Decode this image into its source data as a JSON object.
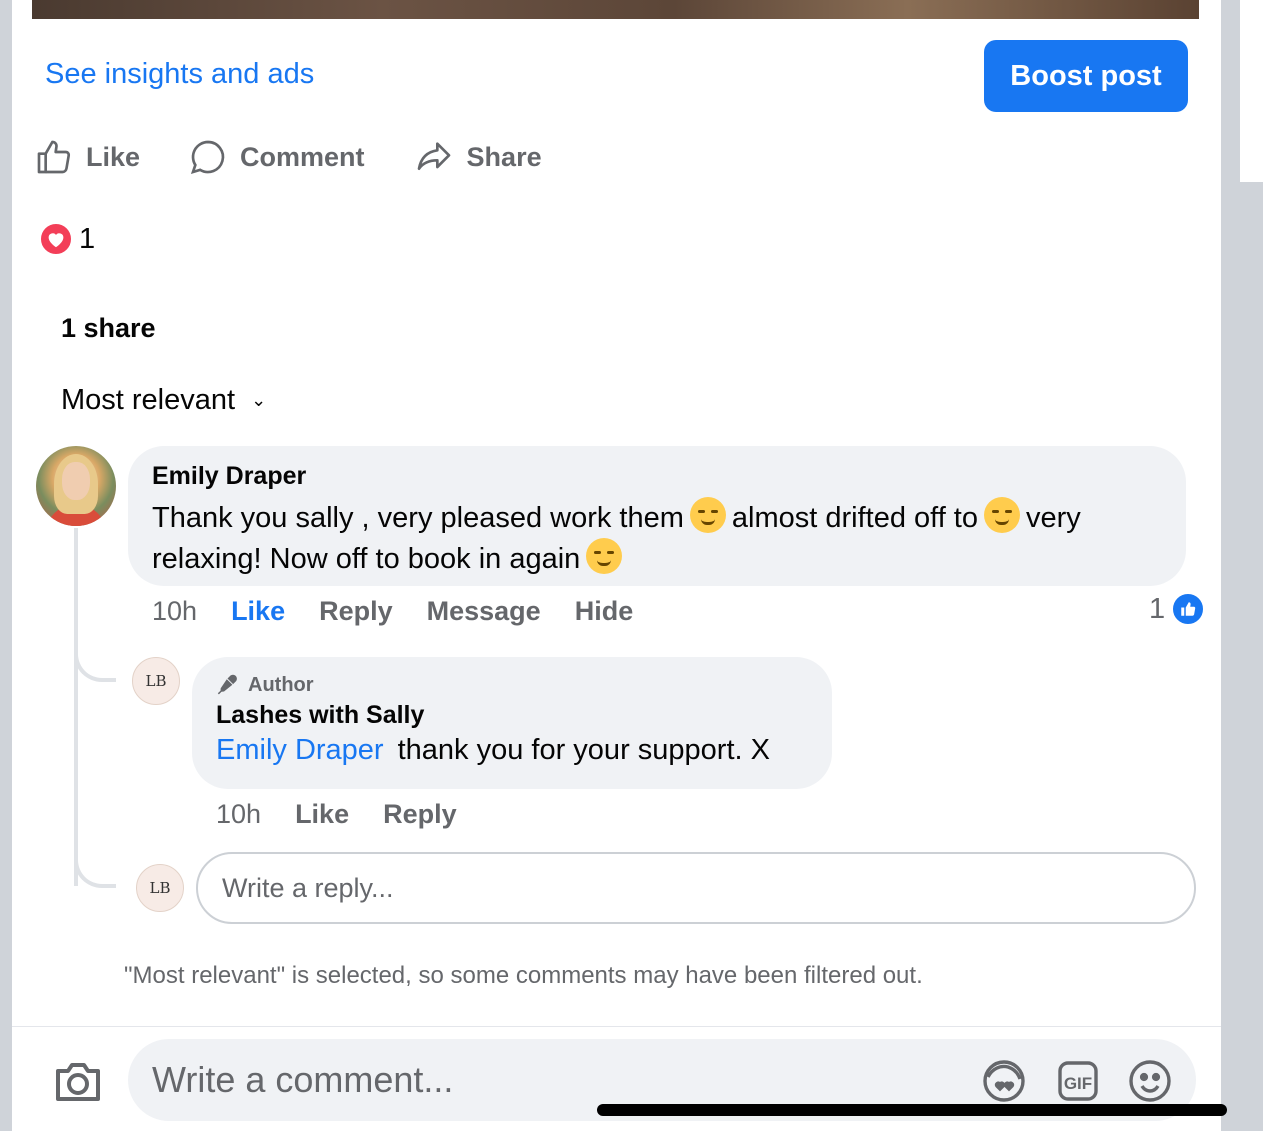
{
  "post": {
    "insights_link": "See insights and ads",
    "boost_button": "Boost post"
  },
  "actions": {
    "like": "Like",
    "comment": "Comment",
    "share": "Share"
  },
  "reactions": {
    "icon": "heart-icon",
    "count": "1"
  },
  "shares": "1 share",
  "sort": {
    "label": "Most relevant",
    "chevron": "⌄"
  },
  "comments": [
    {
      "author": "Emily Draper",
      "text_1": "Thank you sally , very pleased work them",
      "text_2": "almost drifted off to",
      "text_3": "very relaxing! Now off to book in again",
      "time": "10h",
      "like": "Like",
      "reply": "Reply",
      "message": "Message",
      "hide": "Hide",
      "like_count": "1",
      "replies": [
        {
          "badge": "Author",
          "author": "Lashes with Sally",
          "avatar_text": "LB",
          "mention": "Emily Draper",
          "text": "thank you for your support. X",
          "time": "10h",
          "like": "Like",
          "reply": "Reply"
        }
      ]
    }
  ],
  "reply_input": {
    "placeholder": "Write a reply...",
    "avatar_text": "LB"
  },
  "filter_note": "\"Most relevant\" is selected, so some comments may have been filtered out.",
  "composer": {
    "placeholder": "Write a comment...",
    "icons": [
      "camera-icon",
      "avatar-sticker-icon",
      "gif-icon",
      "emoji-icon"
    ]
  },
  "colors": {
    "accent": "#1877f2",
    "heart": "#f33e58",
    "bubble": "#f0f2f5",
    "muted_text": "#65676b"
  }
}
